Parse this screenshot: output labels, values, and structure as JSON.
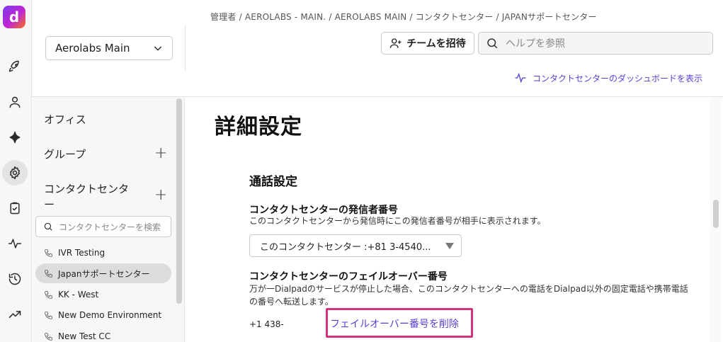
{
  "rail": {
    "logo_letter": "d",
    "icons": [
      "rocket-icon",
      "person-icon",
      "sparkle-icon",
      "gear-icon",
      "clipboard-icon",
      "pulse-icon",
      "history-icon",
      "trending-icon"
    ]
  },
  "header": {
    "org_select": "Aerolabs Main",
    "breadcrumb": "管理者 / AEROLABS - MAIN. / AEROLABS MAIN / コンタクトセンター / JAPANサポートセンター",
    "invite_button": "チームを招待",
    "help_search_placeholder": "ヘルプを参照",
    "dashboard_link": "コンタクトセンターのダッシュボードを表示"
  },
  "sidebar": {
    "office": "オフィス",
    "group": "グループ",
    "contact_center": "コンタクトセンター",
    "search_placeholder": "コンタクトセンターを検索",
    "items": [
      {
        "label": "IVR Testing"
      },
      {
        "label": "Japanサポートセンター"
      },
      {
        "label": "KK - West"
      },
      {
        "label": "New Demo Environment"
      },
      {
        "label": "New Test CC"
      }
    ]
  },
  "main": {
    "page_title": "詳細設定",
    "section_title": "通話設定",
    "caller_id": {
      "label": "コンタクトセンターの発信者番号",
      "description": "このコンタクトセンターから発信時にこの発信者番号が相手に表示されます。",
      "value": "このコンタクトセンター :+81 3-4540..."
    },
    "failover": {
      "label": "コンタクトセンターのフェイルオーバー番号",
      "description": "万が一Dialpadのサービスが停止した場合、このコンタクトセンターへの電話をDialpad以外の固定電話や携帯電話の番号へ転送します。",
      "number": "+1 438-",
      "remove_link": "フェイルオーバー番号を削除"
    }
  },
  "colors": {
    "accent": "#5a3fd6",
    "highlight_box": "#d4317f"
  }
}
